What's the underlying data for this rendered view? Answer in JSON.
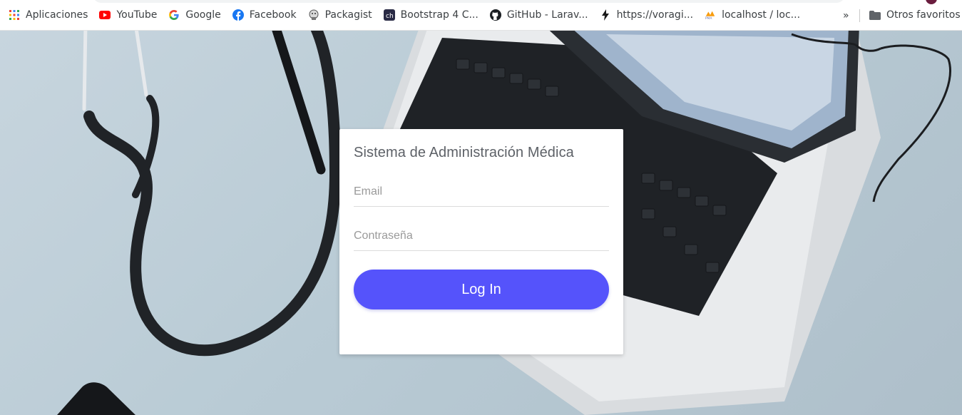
{
  "bookmarks": {
    "items": [
      {
        "label": "Aplicaciones",
        "icon": "apps-grid-icon"
      },
      {
        "label": "YouTube",
        "icon": "youtube-icon"
      },
      {
        "label": "Google",
        "icon": "google-icon"
      },
      {
        "label": "Facebook",
        "icon": "facebook-icon"
      },
      {
        "label": "Packagist",
        "icon": "packagist-icon"
      },
      {
        "label": "Bootstrap 4 C...",
        "icon": "bootstrap-icon"
      },
      {
        "label": "GitHub - Larav...",
        "icon": "github-icon"
      },
      {
        "label": "https://voragi...",
        "icon": "bolt-icon"
      },
      {
        "label": "localhost / loc...",
        "icon": "phpmyadmin-icon"
      }
    ],
    "more": "»",
    "other_favorites": "Otros favoritos"
  },
  "login": {
    "title": "Sistema de Administración Médica",
    "email_placeholder": "Email",
    "password_placeholder": "Contraseña",
    "button_label": "Log In"
  },
  "colors": {
    "accent": "#5553fb",
    "card_bg": "#ffffff",
    "scene_bg": "#bccdd7"
  }
}
